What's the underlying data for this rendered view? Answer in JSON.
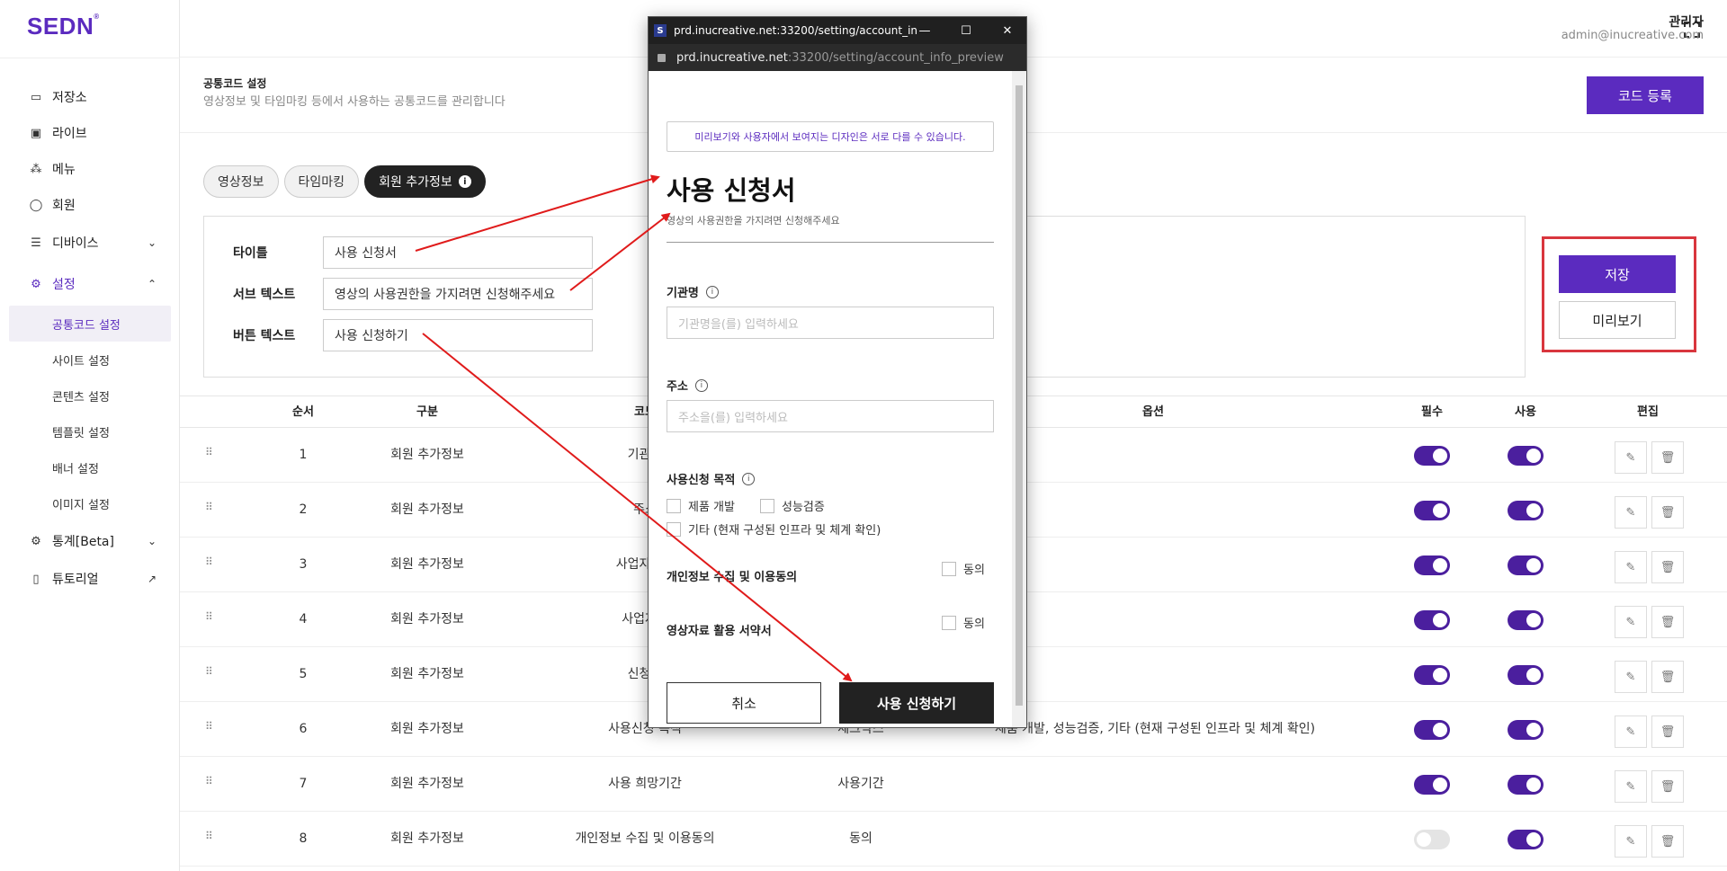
{
  "app": {
    "logo": "SEDN",
    "logo_mark": "®"
  },
  "header": {
    "user_name": "관리자",
    "user_email": "admin@inucreative.com"
  },
  "sidebar": {
    "items": [
      {
        "label": "저장소",
        "icon": "storage-icon"
      },
      {
        "label": "라이브",
        "icon": "live-icon"
      },
      {
        "label": "메뉴",
        "icon": "menu-icon"
      },
      {
        "label": "회원",
        "icon": "user-icon"
      },
      {
        "label": "디바이스",
        "icon": "device-icon",
        "chevron": "⌄"
      },
      {
        "label": "설정",
        "icon": "gear-icon",
        "chevron": "⌃"
      }
    ],
    "sub_items": [
      "공통코드 설정",
      "사이트 설정",
      "콘텐츠 설정",
      "템플릿 설정",
      "배너 설정",
      "이미지 설정"
    ],
    "bottom_items": [
      {
        "label": "통계[Beta]",
        "icon": "stats-icon",
        "chevron": "⌄"
      },
      {
        "label": "튜토리얼",
        "icon": "book-icon",
        "chevron": "↗"
      }
    ]
  },
  "page": {
    "title": "공통코드 설정",
    "desc": "영상정보 및 타임마킹 등에서 사용하는 공통코드를 관리합니다",
    "register_btn": "코드 등록",
    "tabs": [
      "영상정보",
      "타임마킹",
      "회원 추가정보"
    ],
    "tab_info": "i"
  },
  "form": {
    "title_label": "타이틀",
    "title_value": "사용 신청서",
    "subtext_label": "서브 텍스트",
    "subtext_value": "영상의 사용권한을 가지려면 신청해주세요",
    "button_label": "버튼 텍스트",
    "button_value": "사용 신청하기",
    "save_btn": "저장",
    "preview_btn": "미리보기"
  },
  "table": {
    "headers": {
      "order": "순서",
      "category": "구분",
      "code": "코드",
      "option": "옵션",
      "required": "필수",
      "use": "사용",
      "edit": "편집"
    },
    "rows": [
      {
        "order": "1",
        "category": "회원 추가정보",
        "code": "기관명",
        "type": "",
        "option": "",
        "required": true,
        "use": true
      },
      {
        "order": "2",
        "category": "회원 추가정보",
        "code": "주소",
        "type": "",
        "option": "",
        "required": true,
        "use": true
      },
      {
        "order": "3",
        "category": "회원 추가정보",
        "code": "사업자등록",
        "type": "",
        "option": "",
        "required": true,
        "use": true
      },
      {
        "order": "4",
        "category": "회원 추가정보",
        "code": "사업자등",
        "type": "",
        "option": "",
        "required": true,
        "use": true
      },
      {
        "order": "5",
        "category": "회원 추가정보",
        "code": "신청인",
        "type": "",
        "option": "",
        "required": true,
        "use": true
      },
      {
        "order": "6",
        "category": "회원 추가정보",
        "code": "사용신청 목적",
        "type": "체크박스",
        "option": "제품 개발, 성능검증, 기타 (현재 구성된 인프라 및 체계 확인)",
        "required": true,
        "use": true
      },
      {
        "order": "7",
        "category": "회원 추가정보",
        "code": "사용 희망기간",
        "type": "사용기간",
        "option": "",
        "required": true,
        "use": true
      },
      {
        "order": "8",
        "category": "회원 추가정보",
        "code": "개인정보 수집 및 이용동의",
        "type": "동의",
        "option": "",
        "required": false,
        "use": true
      }
    ]
  },
  "popup": {
    "window_title": "prd.inucreative.net:33200/setting/account_inf...",
    "favicon": "S",
    "url_host": "prd.inucreative.net",
    "url_rest": ":33200/setting/account_info_preview",
    "notice": "미리보기와 사용자에서 보여지는 디자인은 서로 다를 수 있습니다.",
    "title": "사용 신청서",
    "subtitle": "영상의 사용권한을 가지려면 신청해주세요",
    "field1_label": "기관명",
    "field1_placeholder": "기관명을(를) 입력하세요",
    "field2_label": "주소",
    "field2_placeholder": "주소을(를) 입력하세요",
    "purpose_label": "사용신청 목적",
    "purpose_options": [
      "제품 개발",
      "성능검증",
      "기타 (현재 구성된 인프라 및 체계 확인)"
    ],
    "privacy_label": "개인정보 수집 및 이용동의",
    "video_label": "영상자료 활용 서약서",
    "agree": "동의",
    "cancel_btn": "취소",
    "submit_btn": "사용 신청하기"
  },
  "colors": {
    "brand": "#5b2bbf",
    "annotation": "#e01b1b",
    "toggle_on": "#4b1f9e"
  }
}
